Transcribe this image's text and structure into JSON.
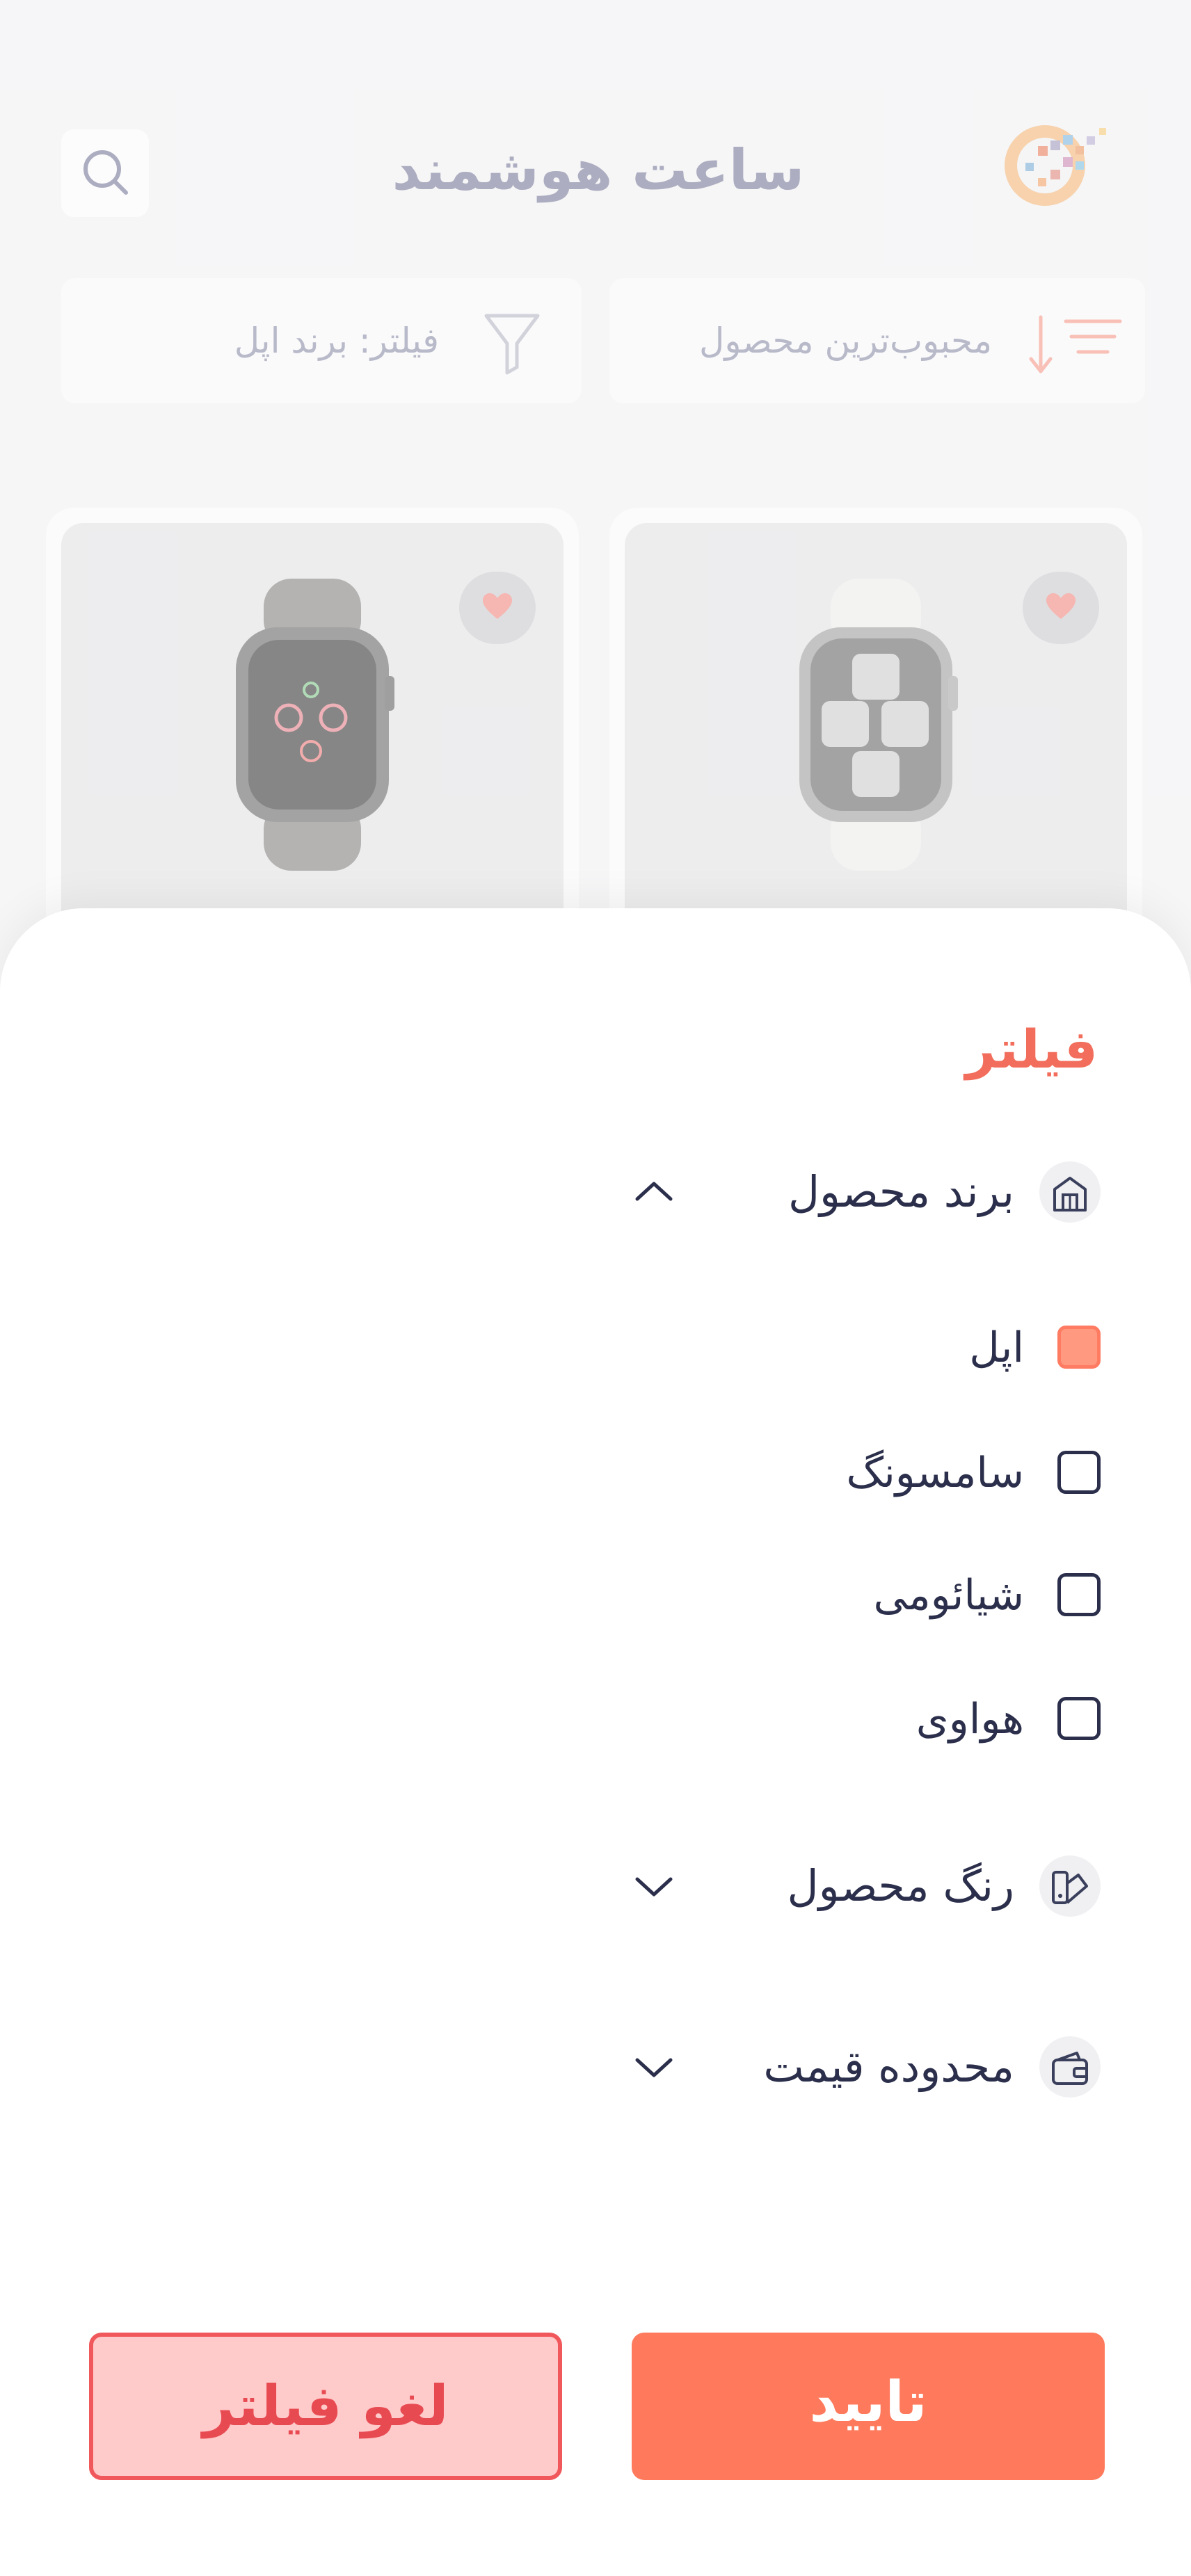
{
  "header": {
    "title": "ساعت هوشمند"
  },
  "toolbar": {
    "sort_label": "محبوب‌ترین محصول",
    "filter_label": "فیلتر: برند اپل"
  },
  "colors": {
    "accent": "#ff7a5c",
    "title_red": "#f26d5b",
    "text_dark": "#2b2f4b",
    "muted": "#9a9cb2",
    "clear_bg": "#ffcaca",
    "clear_border": "#f0585c"
  },
  "filter_sheet": {
    "title": "فیلتر",
    "brand_section": {
      "label": "برند محصول",
      "icon": "store-icon",
      "expanded": true,
      "options": [
        {
          "label": "اپل",
          "checked": true
        },
        {
          "label": "سامسونگ",
          "checked": false
        },
        {
          "label": "شیائومی",
          "checked": false
        },
        {
          "label": "هواوی",
          "checked": false
        }
      ]
    },
    "color_section": {
      "label": "رنگ محصول",
      "icon": "palette-icon",
      "expanded": false
    },
    "price_section": {
      "label": "محدوده قیمت",
      "icon": "wallet-icon",
      "expanded": false
    },
    "confirm_label": "تایید",
    "clear_label": "لغو فیلتر"
  }
}
